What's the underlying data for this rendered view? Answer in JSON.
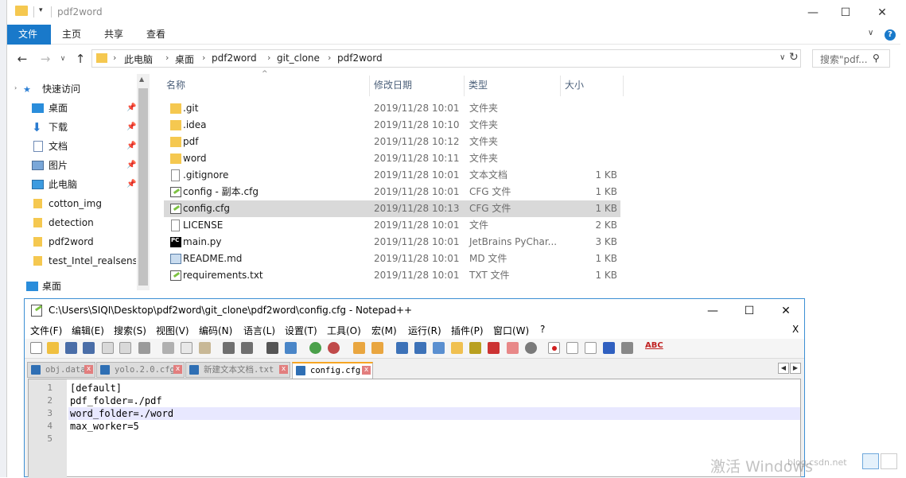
{
  "explorer": {
    "title": "pdf2word",
    "ribbon_tabs": [
      "文件",
      "主页",
      "共享",
      "查看"
    ],
    "help_label": "?",
    "breadcrumb": [
      "此电脑",
      "桌面",
      "pdf2word",
      "git_clone",
      "pdf2word"
    ],
    "search_placeholder": "搜索\"pdf...",
    "nav": {
      "quick_access": "快速访问",
      "items": [
        {
          "label": "桌面",
          "pinned": true
        },
        {
          "label": "下载",
          "pinned": true
        },
        {
          "label": "文档",
          "pinned": true
        },
        {
          "label": "图片",
          "pinned": true
        },
        {
          "label": "此电脑",
          "pinned": true
        },
        {
          "label": "cotton_img",
          "pinned": false
        },
        {
          "label": "detection",
          "pinned": false
        },
        {
          "label": "pdf2word",
          "pinned": false
        },
        {
          "label": "test_Intel_realsense",
          "pinned": false
        }
      ],
      "desktop": "桌面"
    },
    "columns": {
      "name": "名称",
      "date": "修改日期",
      "type": "类型",
      "size": "大小"
    },
    "files": [
      {
        "name": ".git",
        "date": "2019/11/28 10:01",
        "type": "文件夹",
        "size": "",
        "icon": "folder"
      },
      {
        "name": ".idea",
        "date": "2019/11/28 10:10",
        "type": "文件夹",
        "size": "",
        "icon": "folder"
      },
      {
        "name": "pdf",
        "date": "2019/11/28 10:12",
        "type": "文件夹",
        "size": "",
        "icon": "folder"
      },
      {
        "name": "word",
        "date": "2019/11/28 10:11",
        "type": "文件夹",
        "size": "",
        "icon": "folder"
      },
      {
        "name": ".gitignore",
        "date": "2019/11/28 10:01",
        "type": "文本文档",
        "size": "1 KB",
        "icon": "text"
      },
      {
        "name": "config - 副本.cfg",
        "date": "2019/11/28 10:01",
        "type": "CFG 文件",
        "size": "1 KB",
        "icon": "notepadpp"
      },
      {
        "name": "config.cfg",
        "date": "2019/11/28 10:13",
        "type": "CFG 文件",
        "size": "1 KB",
        "icon": "notepadpp"
      },
      {
        "name": "LICENSE",
        "date": "2019/11/28 10:01",
        "type": "文件",
        "size": "2 KB",
        "icon": "blank"
      },
      {
        "name": "main.py",
        "date": "2019/11/28 10:01",
        "type": "JetBrains PyChar...",
        "size": "3 KB",
        "icon": "pycharm"
      },
      {
        "name": "README.md",
        "date": "2019/11/28 10:01",
        "type": "MD 文件",
        "size": "1 KB",
        "icon": "markdown"
      },
      {
        "name": "requirements.txt",
        "date": "2019/11/28 10:01",
        "type": "TXT 文件",
        "size": "1 KB",
        "icon": "notepadpp"
      }
    ],
    "selected_file": "config.cfg"
  },
  "notepad": {
    "title": "C:\\Users\\SIQI\\Desktop\\pdf2word\\git_clone\\pdf2word\\config.cfg - Notepad++",
    "menus": [
      "文件(F)",
      "编辑(E)",
      "搜索(S)",
      "视图(V)",
      "编码(N)",
      "语言(L)",
      "设置(T)",
      "工具(O)",
      "宏(M)",
      "运行(R)",
      "插件(P)",
      "窗口(W)",
      "?"
    ],
    "close_doc": "X",
    "tabs": [
      "obj.data",
      "yolo.2.0.cfg",
      "新建文本文档.txt",
      "config.cfg"
    ],
    "active_tab": "config.cfg",
    "line_numbers": [
      "1",
      "2",
      "3",
      "4",
      "5"
    ],
    "lines": [
      "[default]",
      "pdf_folder=./pdf",
      "word_folder=./word",
      "max_worker=5",
      ""
    ],
    "current_line": 3
  },
  "watermark": {
    "text": "激活 Windows",
    "url": "blog.csdn.net"
  },
  "colors": {
    "accent": "#1979ca",
    "folder": "#f5c850",
    "selected_row": "#d9d9d9",
    "npp_border": "#3c8fd4",
    "tab_highlight": "#f6a623"
  }
}
